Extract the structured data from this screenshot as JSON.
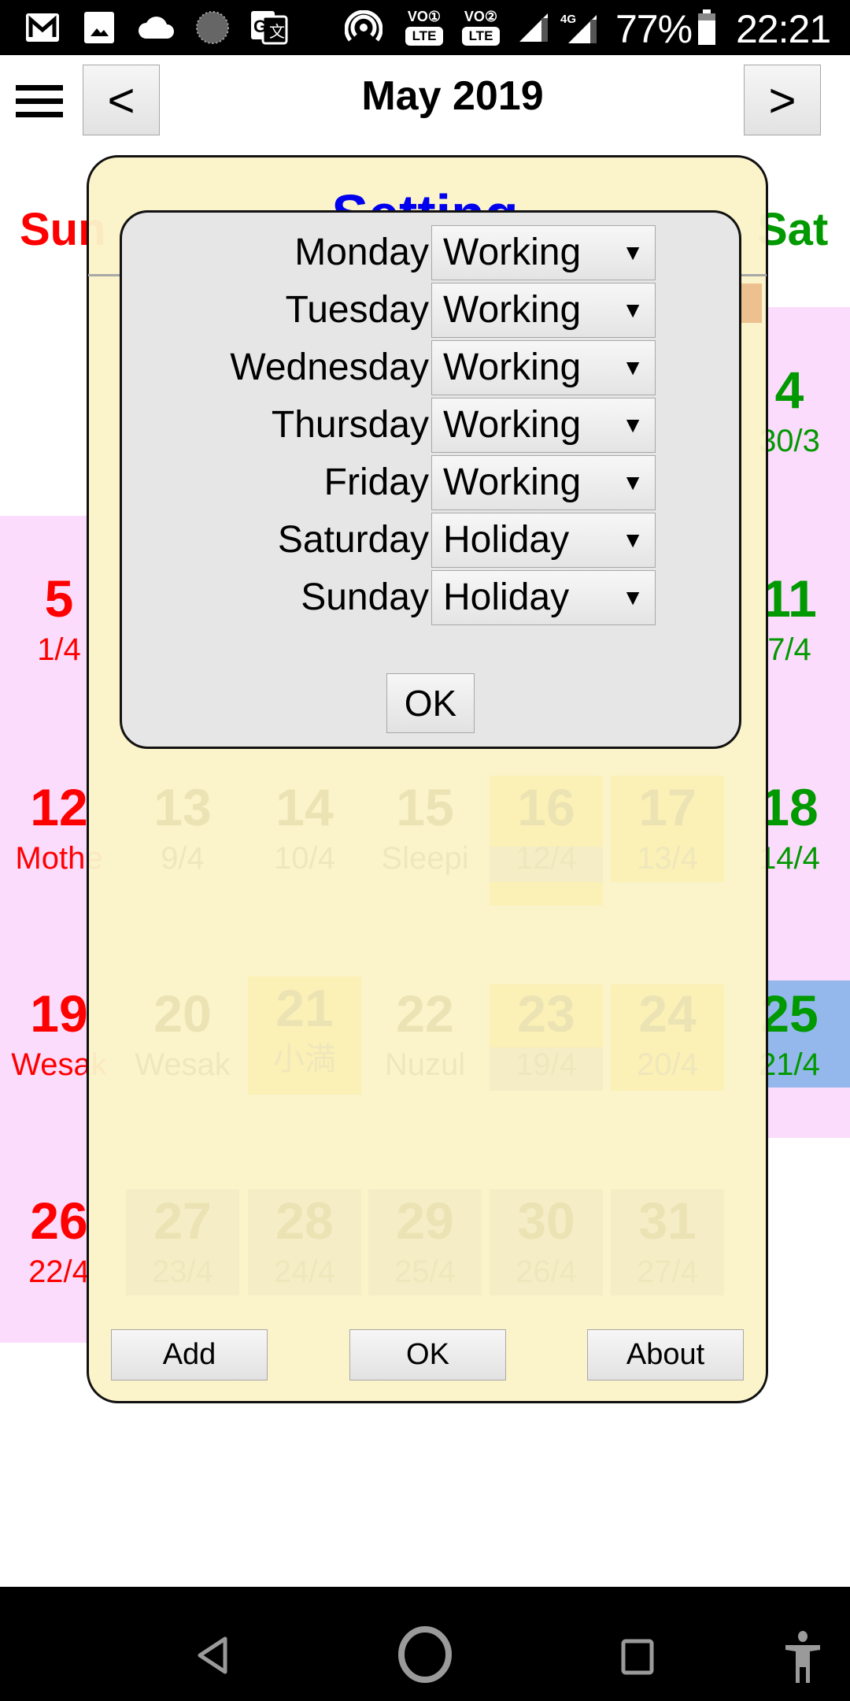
{
  "status_bar": {
    "notification_icons": [
      "gmail-icon",
      "photos-icon",
      "cloud-icon",
      "sync-icon",
      "translate-icon"
    ],
    "system_icons": [
      "hotspot-icon",
      "volte-sim1-icon",
      "volte-sim2-icon",
      "signal-icon",
      "signal-4g-icon",
      "battery-icon"
    ],
    "volte1_label": "VO①",
    "volte2_label": "VO②",
    "lte_label": "LTE",
    "network_label": "4G",
    "battery": "77%",
    "time": "22:21"
  },
  "header": {
    "menu_icon": "hamburger-menu-icon",
    "prev_label": "<",
    "next_label": ">",
    "title": "May 2019"
  },
  "calendar": {
    "weekday_headers": {
      "sun": "Sun",
      "sat": "Sat"
    },
    "colors": {
      "sunday": "#ff0000",
      "saturday": "#009900",
      "weekend_bg": "#fcdcfc",
      "today_bg": "#94b8ec"
    },
    "cells": [
      {
        "day": "4",
        "sub": "30/3",
        "weekday": "sat"
      },
      {
        "day": "5",
        "sub": "1/4",
        "weekday": "sun"
      },
      {
        "day": "11",
        "sub": "7/4",
        "weekday": "sat"
      },
      {
        "day": "12",
        "sub": "Mothe",
        "weekday": "sun"
      },
      {
        "day": "13",
        "sub": "9/4",
        "weekday": "mon"
      },
      {
        "day": "14",
        "sub": "10/4",
        "weekday": "tue"
      },
      {
        "day": "15",
        "sub": "Sleepi",
        "weekday": "wed"
      },
      {
        "day": "16",
        "sub": "12/4",
        "weekday": "thu"
      },
      {
        "day": "17",
        "sub": "13/4",
        "weekday": "fri"
      },
      {
        "day": "18",
        "sub": "14/4",
        "weekday": "sat"
      },
      {
        "day": "19",
        "sub": "Wesak",
        "weekday": "sun"
      },
      {
        "day": "20",
        "sub": "Wesak",
        "weekday": "mon"
      },
      {
        "day": "21",
        "sub": "小満",
        "weekday": "tue"
      },
      {
        "day": "22",
        "sub": "Nuzul",
        "weekday": "wed"
      },
      {
        "day": "23",
        "sub": "19/4",
        "weekday": "thu"
      },
      {
        "day": "24",
        "sub": "20/4",
        "weekday": "fri"
      },
      {
        "day": "25",
        "sub": "21/4",
        "weekday": "sat",
        "today": true
      },
      {
        "day": "26",
        "sub": "22/4",
        "weekday": "sun"
      },
      {
        "day": "27",
        "sub": "23/4",
        "weekday": "mon"
      },
      {
        "day": "28",
        "sub": "24/4",
        "weekday": "tue"
      },
      {
        "day": "29",
        "sub": "25/4",
        "weekday": "wed"
      },
      {
        "day": "30",
        "sub": "26/4",
        "weekday": "thu"
      },
      {
        "day": "31",
        "sub": "27/4",
        "weekday": "fri"
      }
    ]
  },
  "setting_panel": {
    "title": "Setting",
    "buttons": {
      "add": "Add",
      "ok": "OK",
      "about": "About"
    }
  },
  "workday_dialog": {
    "rows": [
      {
        "day": "Monday",
        "value": "Working"
      },
      {
        "day": "Tuesday",
        "value": "Working"
      },
      {
        "day": "Wednesday",
        "value": "Working"
      },
      {
        "day": "Thursday",
        "value": "Working"
      },
      {
        "day": "Friday",
        "value": "Working"
      },
      {
        "day": "Saturday",
        "value": "Holiday"
      },
      {
        "day": "Sunday",
        "value": "Holiday"
      }
    ],
    "arrow": "▼",
    "ok_label": "OK"
  },
  "nav_bar": {
    "buttons": [
      "back-icon",
      "home-icon",
      "recents-icon",
      "accessibility-icon"
    ]
  }
}
